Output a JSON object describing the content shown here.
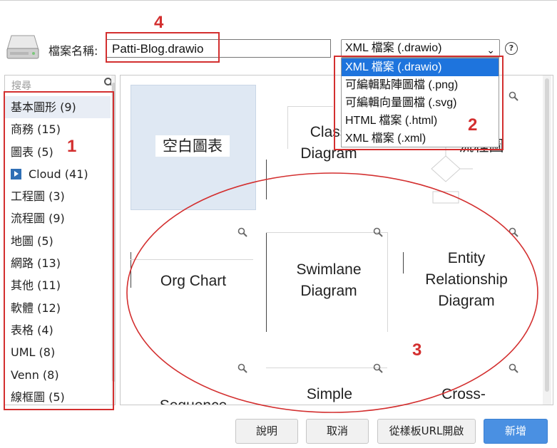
{
  "dialog": {
    "filename_label": "檔案名稱:",
    "filename_value": "Patti-Blog.drawio",
    "format_selected": "XML 檔案 (.drawio)",
    "help_glyph": "?",
    "format_options": [
      "XML 檔案 (.drawio)",
      "可編輯點陣圖檔 (.png)",
      "可編輯向量圖檔 (.svg)",
      "HTML 檔案 (.html)",
      "XML 檔案 (.xml)"
    ]
  },
  "sidebar": {
    "search_placeholder": "搜尋",
    "categories": [
      {
        "label": "基本圖形 (9)"
      },
      {
        "label": "商務 (15)"
      },
      {
        "label": "圖表 (5)"
      },
      {
        "label": "Cloud (41)"
      },
      {
        "label": "工程圖 (3)"
      },
      {
        "label": "流程圖 (9)"
      },
      {
        "label": "地圖 (5)"
      },
      {
        "label": "網路 (13)"
      },
      {
        "label": "其他 (11)"
      },
      {
        "label": "軟體 (12)"
      },
      {
        "label": "表格 (4)"
      },
      {
        "label": "UML (8)"
      },
      {
        "label": "Venn (8)"
      },
      {
        "label": "線框圖 (5)"
      }
    ]
  },
  "templates": {
    "blank": "空白圖表",
    "class_diagram": "Class Diagram",
    "flowchart_partial": "流程圖",
    "org_chart": "Org Chart",
    "swimlane": "Swimlane Diagram",
    "entity_relationship": "Entity Relationship Diagram",
    "sequence": "Sequence",
    "simple": "Simple",
    "cross": "Cross-"
  },
  "buttons": {
    "help": "說明",
    "cancel": "取消",
    "open_url": "從樣板URL開啟",
    "create": "新增"
  },
  "annotations": {
    "n1": "1",
    "n2": "2",
    "n3": "3",
    "n4": "4"
  },
  "colors": {
    "annotation_red": "#d32f2f",
    "primary_button": "#4a90e2",
    "dropdown_selected": "#1e74dd"
  }
}
